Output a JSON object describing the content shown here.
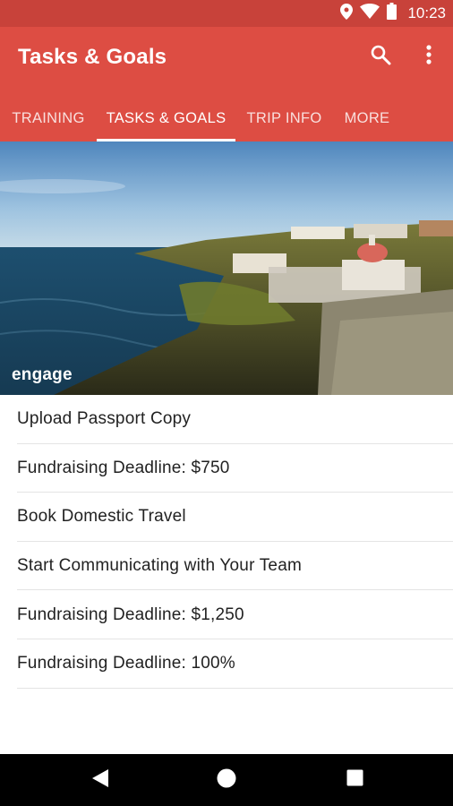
{
  "status_bar": {
    "time": "10:23",
    "icons": [
      "location-icon",
      "wifi-icon",
      "battery-icon"
    ]
  },
  "app_bar": {
    "title": "Tasks & Goals",
    "actions": [
      "search-icon",
      "overflow-menu-icon"
    ],
    "color": "#dd4d43",
    "status_color": "#c8423a"
  },
  "tabs": [
    {
      "label": "TRAINING",
      "active": false
    },
    {
      "label": "TASKS & GOALS",
      "active": true
    },
    {
      "label": "TRIP INFO",
      "active": false
    },
    {
      "label": "MORE",
      "active": false
    }
  ],
  "hero": {
    "logo_text": "engage"
  },
  "tasks": [
    {
      "label": "Upload Passport Copy"
    },
    {
      "label": "Fundraising Deadline: $750"
    },
    {
      "label": "Book Domestic Travel"
    },
    {
      "label": "Start Communicating with Your Team"
    },
    {
      "label": "Fundraising Deadline: $1,250"
    },
    {
      "label": "Fundraising Deadline: 100%"
    }
  ],
  "nav_bar": {
    "buttons": [
      "back-icon",
      "home-icon",
      "recents-icon"
    ]
  }
}
